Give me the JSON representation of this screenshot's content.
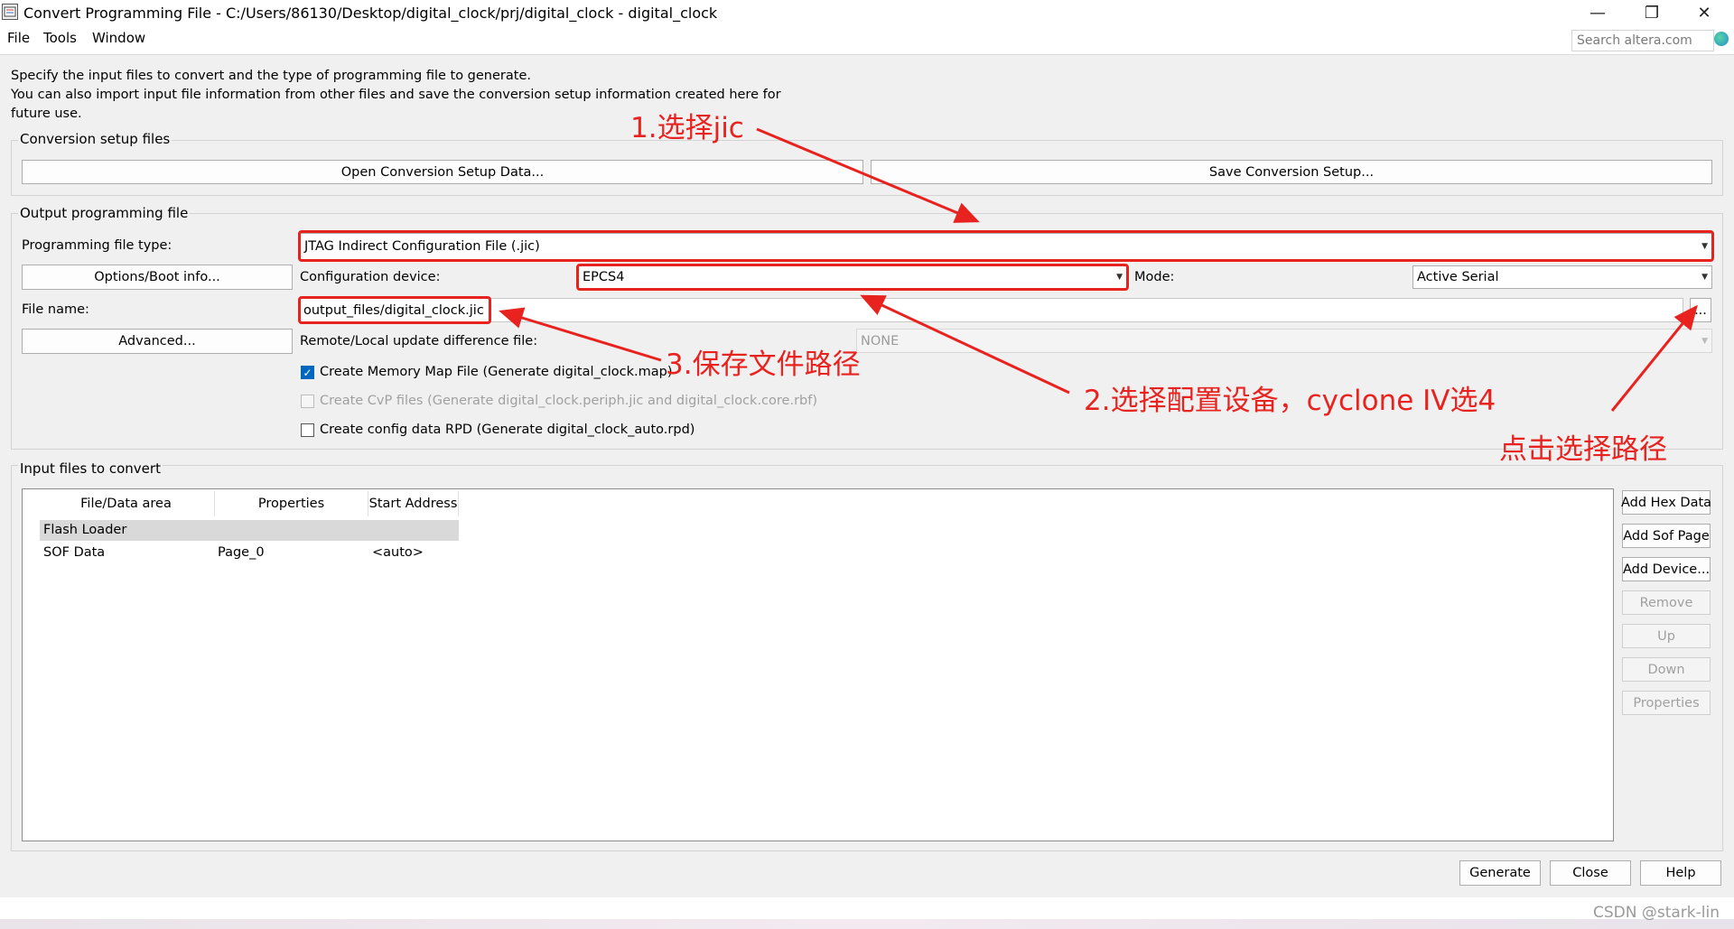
{
  "window": {
    "title": "Convert Programming File - C:/Users/86130/Desktop/digital_clock/prj/digital_clock - digital_clock",
    "minimize_glyph": "—",
    "restore_glyph": "❐",
    "close_glyph": "✕"
  },
  "menu": {
    "file": "File",
    "tools": "Tools",
    "window": "Window"
  },
  "search": {
    "placeholder": "Search altera.com"
  },
  "description": {
    "line1": "Specify the input files to convert and the type of programming file to generate.",
    "line2": "You can also import input file information from other files and save the conversion setup information created here for",
    "line3": "future use."
  },
  "conversion_setup": {
    "title": "Conversion setup files",
    "open_button": "Open Conversion Setup Data...",
    "save_button": "Save Conversion Setup..."
  },
  "output": {
    "title": "Output programming file",
    "file_type_label": "Programming file type:",
    "file_type_value": "JTAG Indirect Configuration File (.jic)",
    "options_button": "Options/Boot info...",
    "config_device_label": "Configuration device:",
    "config_device_value": "EPCS4",
    "mode_label": "Mode:",
    "mode_value": "Active Serial",
    "file_name_label": "File name:",
    "file_name_value": "output_files/digital_clock.jic",
    "browse_button": "...",
    "advanced_button": "Advanced...",
    "remote_label": "Remote/Local update difference file:",
    "remote_value": "NONE",
    "create_map_label": "Create Memory Map File (Generate digital_clock.map)",
    "create_cvp_label": "Create CvP files (Generate digital_clock.periph.jic and digital_clock.core.rbf)",
    "create_rpd_label": "Create config data RPD (Generate digital_clock_auto.rpd)"
  },
  "input_files": {
    "title": "Input files to convert",
    "columns": [
      "File/Data area",
      "Properties",
      "Start Address"
    ],
    "rows": [
      {
        "area": "Flash Loader",
        "properties": "",
        "address": ""
      },
      {
        "area": "SOF Data",
        "properties": "Page_0",
        "address": "<auto>"
      }
    ],
    "buttons": {
      "add_hex": "Add Hex Data",
      "add_sof": "Add Sof Page",
      "add_device": "Add Device...",
      "remove": "Remove",
      "up": "Up",
      "down": "Down",
      "properties": "Properties"
    }
  },
  "footer": {
    "generate": "Generate",
    "close": "Close",
    "help": "Help"
  },
  "annotations": {
    "step1": "1.选择jic",
    "step2": "2.选择配置设备，cyclone IV选4",
    "step3": "3.保存文件路径",
    "click_path": "点击选择路径",
    "color": "#e8231f"
  },
  "watermark": "CSDN @stark-lin"
}
